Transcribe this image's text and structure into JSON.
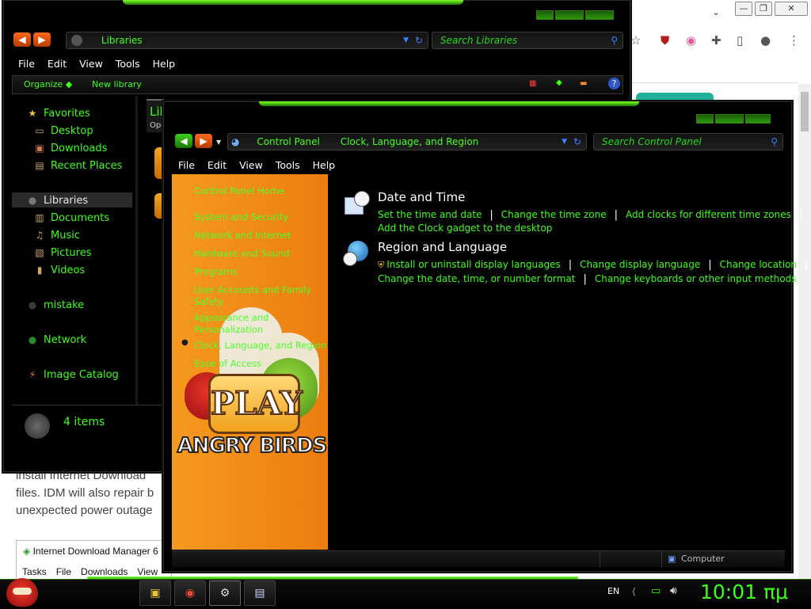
{
  "browser": {
    "text_lines": [
      "install Internet Download",
      "files. IDM will also repair b",
      "unexpected power outage"
    ],
    "idm_window": {
      "title": "Internet Download Manager 6",
      "menu": [
        "Tasks",
        "File",
        "Downloads",
        "View"
      ]
    },
    "window_controls": [
      "chevron-down",
      "minimize",
      "restore",
      "close"
    ]
  },
  "libraries_window": {
    "address": "Libraries",
    "search_placeholder": "Search Libraries",
    "menu": [
      "File",
      "Edit",
      "View",
      "Tools",
      "Help"
    ],
    "toolbar": {
      "organize": "Organize",
      "new_library": "New library"
    },
    "heading_partial": "Lib",
    "subheading_partial": "Ope",
    "nav": {
      "favorites": "Favorites",
      "favorite_items": [
        "Desktop",
        "Downloads",
        "Recent Places"
      ],
      "libraries": "Libraries",
      "library_items": [
        "Documents",
        "Music",
        "Pictures",
        "Videos"
      ],
      "mistake": "mistake",
      "network": "Network",
      "image_catalog": "Image Catalog"
    },
    "status": "4 items"
  },
  "control_panel_window": {
    "breadcrumb": [
      "Control Panel",
      "Clock, Language, and Region"
    ],
    "search_placeholder": "Search Control Panel",
    "menu": [
      "File",
      "Edit",
      "View",
      "Tools",
      "Help"
    ],
    "sidebar": {
      "home": "Control Panel Home",
      "items": [
        "System and Security",
        "Network and Internet",
        "Hardware and Sound",
        "Programs",
        "User Accounts and Family Safety",
        "Appearance and Personalization",
        "Clock, Language, and Region",
        "Ease of Access"
      ],
      "selected": "Clock, Language, and Region",
      "artwork_text": {
        "play": "PLAY",
        "brand": "ANGRY BIRDS"
      }
    },
    "sections": [
      {
        "title": "Date and Time",
        "links": [
          "Set the time and date",
          "Change the time zone",
          "Add clocks for different time zones",
          "Add the Clock gadget to the desktop"
        ]
      },
      {
        "title": "Region and Language",
        "links": [
          "Install or uninstall display languages",
          "Change display language",
          "Change location",
          "Change the date, time, or number format",
          "Change keyboards or other input methods"
        ]
      }
    ],
    "status": "Computer"
  },
  "taskbar": {
    "language": "EN",
    "clock": "10:01 πμ",
    "pinned": [
      "explorer",
      "chrome",
      "control-panel",
      "network-tool"
    ]
  },
  "colors": {
    "accent_green": "#3cff18",
    "sidebar_orange": "#f08a17",
    "window_bg": "#000000"
  }
}
